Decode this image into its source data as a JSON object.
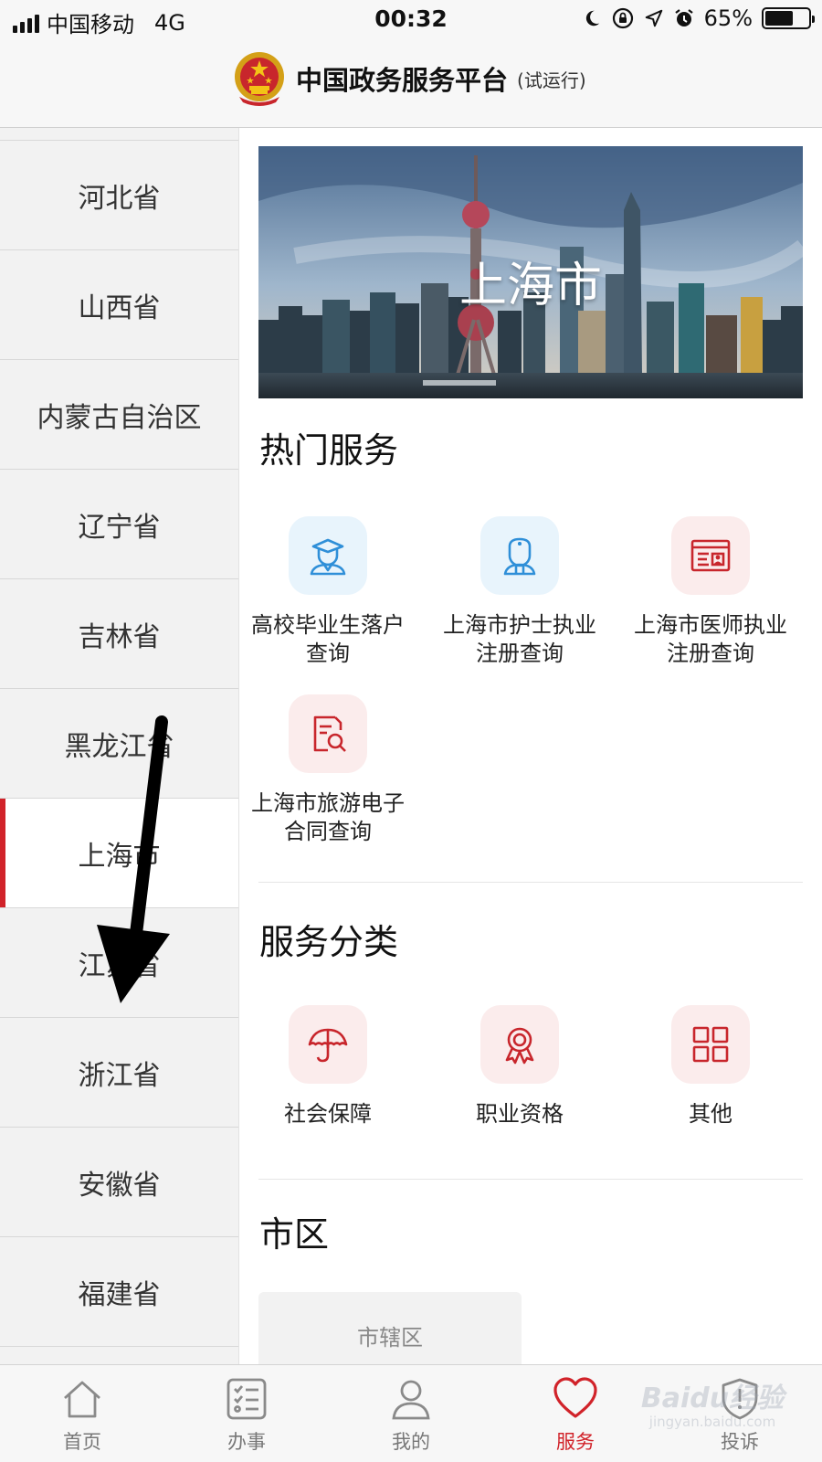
{
  "status_bar": {
    "carrier": "中国移动",
    "network": "4G",
    "time": "00:32",
    "battery_text": "65%",
    "battery_level": 0.65,
    "icons": [
      "signal-icon",
      "moon-icon",
      "orientation-lock-icon",
      "location-icon",
      "alarm-icon",
      "battery-icon"
    ]
  },
  "header": {
    "title": "中国政务服务平台",
    "subtitle": "(试运行)",
    "logo": "national-emblem-icon"
  },
  "sidebar": {
    "provinces": [
      "河北省",
      "山西省",
      "内蒙古自治区",
      "辽宁省",
      "吉林省",
      "黑龙江省",
      "上海市",
      "江苏省",
      "浙江省",
      "安徽省",
      "福建省"
    ],
    "active_index": 6,
    "accent_color": "#d1232a"
  },
  "main": {
    "banner_title": "上海市",
    "hot_services": {
      "title": "热门服务",
      "items": [
        {
          "line1": "高校毕业生落户",
          "line2": "查询",
          "icon": "graduate-icon",
          "tone": "blue"
        },
        {
          "line1": "上海市护士执业",
          "line2": "注册查询",
          "icon": "nurse-icon",
          "tone": "blue"
        },
        {
          "line1": "上海市医师执业",
          "line2": "注册查询",
          "icon": "id-card-icon",
          "tone": "red"
        },
        {
          "line1": "上海市旅游电子",
          "line2": "合同查询",
          "icon": "document-search-icon",
          "tone": "red"
        }
      ]
    },
    "categories": {
      "title": "服务分类",
      "items": [
        {
          "label": "社会保障",
          "icon": "umbrella-icon"
        },
        {
          "label": "职业资格",
          "icon": "award-icon"
        },
        {
          "label": "其他",
          "icon": "grid-icon"
        }
      ]
    },
    "district": {
      "title": "市区",
      "button": "市辖区"
    }
  },
  "tabbar": {
    "tabs": [
      {
        "label": "首页",
        "icon": "home-icon"
      },
      {
        "label": "办事",
        "icon": "checklist-icon"
      },
      {
        "label": "我的",
        "icon": "user-icon"
      },
      {
        "label": "服务",
        "icon": "heart-icon"
      },
      {
        "label": "投诉",
        "icon": "shield-icon"
      }
    ],
    "active_index": 3
  },
  "watermark": {
    "brand": "Baidu经验",
    "url": "jingyan.baidu.com"
  },
  "colors": {
    "accent": "#d1232a",
    "icon_blue": "#2f8fd8",
    "icon_red": "#c8262c"
  }
}
